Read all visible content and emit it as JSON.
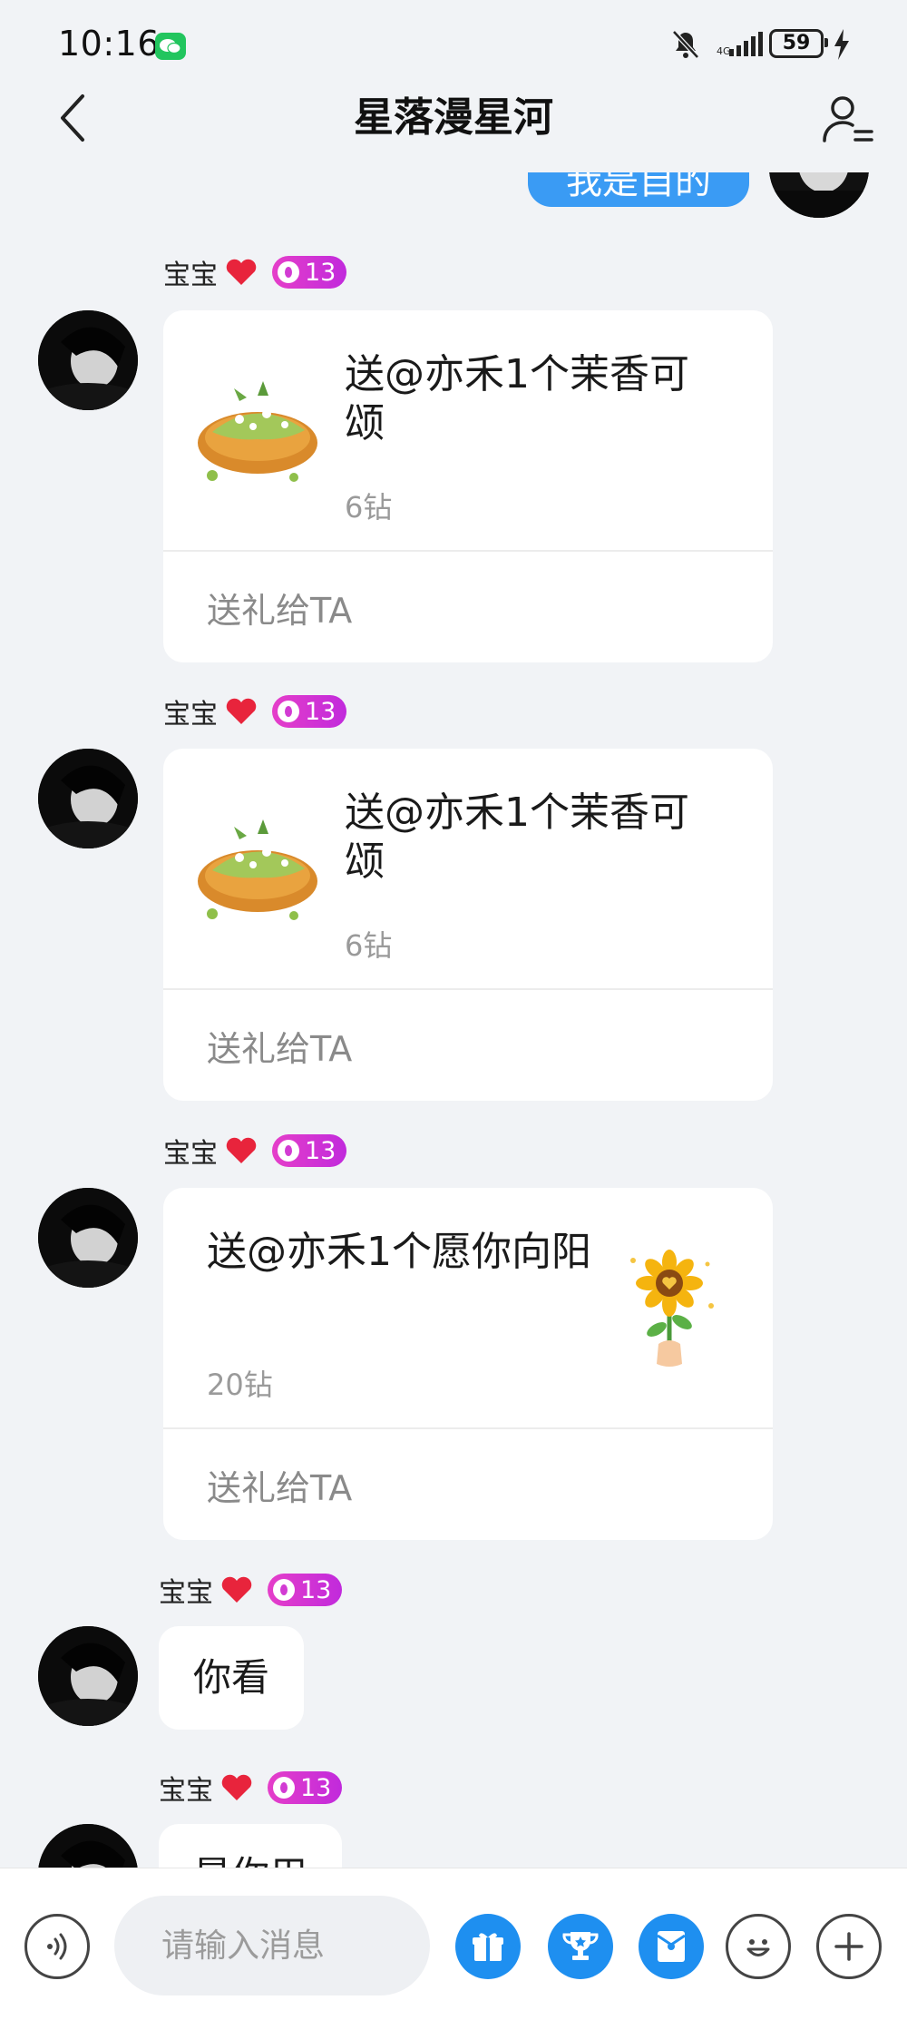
{
  "status": {
    "time": "10:16",
    "battery": "59"
  },
  "nav": {
    "title": "星落漫星河"
  },
  "sent": {
    "text": "我是自的"
  },
  "messages": [
    {
      "sender": "宝宝",
      "level": "13",
      "gift_text": "送@亦禾1个茉香可颂",
      "price": "6钻",
      "action": "送礼给TA",
      "gift": "croissant-image"
    },
    {
      "sender": "宝宝",
      "level": "13",
      "gift_text": "送@亦禾1个茉香可颂",
      "price": "6钻",
      "action": "送礼给TA",
      "gift": "croissant-image"
    },
    {
      "sender": "宝宝",
      "level": "13",
      "gift_text": "送@亦禾1个愿你向阳",
      "price": "20钻",
      "action": "送礼给TA",
      "gift": "sunflower-image"
    },
    {
      "sender": "宝宝",
      "level": "13",
      "text": "你看"
    },
    {
      "sender": "宝宝",
      "level": "13",
      "text": "是你用"
    }
  ],
  "input": {
    "placeholder": "请输入消息"
  },
  "icons": [
    "back-icon",
    "profile-menu-icon",
    "voice-icon",
    "gift-icon",
    "trophy-icon",
    "red-packet-icon",
    "emoji-icon",
    "plus-icon"
  ],
  "colors": {
    "accent": "#1e8ff0",
    "sent_bubble": "#3a9bf4",
    "level_badge": "#d63bd6"
  }
}
